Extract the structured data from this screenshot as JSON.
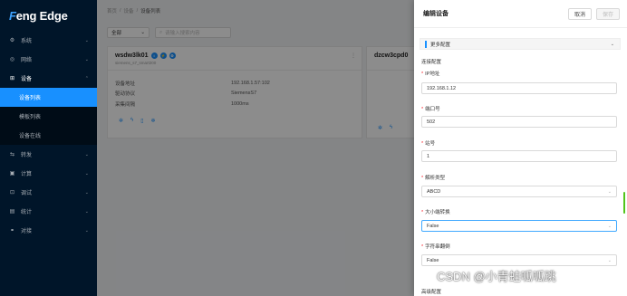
{
  "brand": {
    "logo_first": "F",
    "logo_rest": "eng Edge"
  },
  "sidebar": {
    "items": [
      {
        "label": "系统",
        "icon": "gear-icon"
      },
      {
        "label": "网络",
        "icon": "globe-icon"
      },
      {
        "label": "设备",
        "icon": "device-icon",
        "open": true,
        "children": [
          {
            "label": "设备列表",
            "active": true
          },
          {
            "label": "模板列表"
          },
          {
            "label": "设备在线"
          }
        ]
      },
      {
        "label": "转发",
        "icon": "forward-icon"
      },
      {
        "label": "计算",
        "icon": "calculator-icon"
      },
      {
        "label": "调试",
        "icon": "debug-icon"
      },
      {
        "label": "统计",
        "icon": "chart-icon"
      },
      {
        "label": "对接",
        "icon": "link-icon"
      }
    ]
  },
  "breadcrumb": {
    "items": [
      "首页",
      "设备",
      "设备列表"
    ],
    "sep": "/"
  },
  "filter": {
    "select_value": "全部",
    "search_placeholder": "请输入搜索内容"
  },
  "cards": [
    {
      "title": "wsdw3lk01",
      "subtitle": "siemens_s7_smart200",
      "rows": [
        {
          "k": "设备地址",
          "v": "192.168.1.57:102"
        },
        {
          "k": "驱动协议",
          "v": "SiemensS7"
        },
        {
          "k": "采集间隔",
          "v": "1000ms"
        }
      ]
    },
    {
      "title": "dzcw3cpd0"
    }
  ],
  "drawer": {
    "title": "编辑设备",
    "cancel_label": "取消",
    "save_label": "保存",
    "section_label": "更多配置",
    "group1": "连接配置",
    "fields": [
      {
        "label": "IP地址",
        "value": "192.168.1.12"
      },
      {
        "label": "端口号",
        "value": "502"
      },
      {
        "label": "站号",
        "value": "1"
      },
      {
        "label": "解析类型",
        "value": "ABCD"
      },
      {
        "label": "大小端转换",
        "value": "False"
      },
      {
        "label": "字符串翻倒",
        "value": "False"
      }
    ],
    "group2": "高级配置"
  },
  "watermark": "CSDN @小青蛙呱呱跳",
  "colors": {
    "sidebar_bg": "#001529",
    "accent": "#1890ff",
    "required": "#f5222d",
    "scroll_thumb": "#52c41a"
  }
}
